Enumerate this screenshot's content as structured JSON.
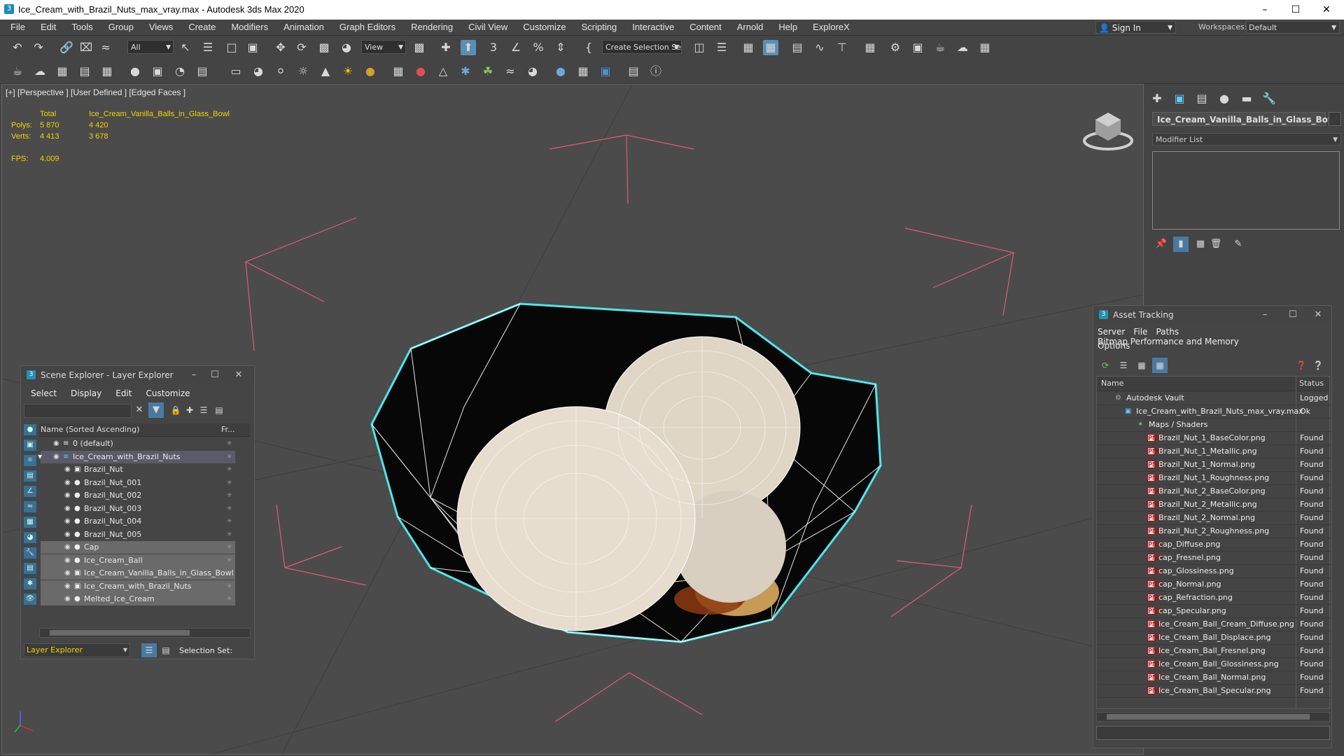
{
  "window": {
    "title": "Ice_Cream_with_Brazil_Nuts_max_vray.max - Autodesk 3ds Max 2020"
  },
  "menu": [
    "File",
    "Edit",
    "Tools",
    "Group",
    "Views",
    "Create",
    "Modifiers",
    "Animation",
    "Graph Editors",
    "Rendering",
    "Civil View",
    "Customize",
    "Scripting",
    "Interactive",
    "Content",
    "Arnold",
    "Help",
    "ExploreX"
  ],
  "account": {
    "sign_in": "Sign In",
    "workspaces_label": "Workspaces:",
    "workspace": "Default"
  },
  "toolbar": {
    "selection_filter": "All",
    "ref_coord": "View",
    "create_selection_set": "Create Selection Se"
  },
  "viewport": {
    "label": "[+] [Perspective ] [User Defined ] [Edged Faces ]",
    "stats": {
      "total_label": "Total",
      "object_name": "Ice_Cream_Vanilla_Balls_in_Glass_Bowl",
      "polys_label": "Polys:",
      "polys_total": "5 870",
      "polys_obj": "4 420",
      "verts_label": "Verts:",
      "verts_total": "4 413",
      "verts_obj": "3 678",
      "fps_label": "FPS:",
      "fps": "4.009"
    }
  },
  "command_panel": {
    "object_name": "Ice_Cream_Vanilla_Balls_in_Glass_Bowl",
    "modifier_list": "Modifier List"
  },
  "scene_explorer": {
    "title": "Scene Explorer - Layer Explorer",
    "menu": [
      "Select",
      "Display",
      "Edit",
      "Customize"
    ],
    "col_name": "Name (Sorted Ascending)",
    "col_frozen": "Fr...",
    "rows": [
      {
        "label": "0 (default)",
        "indent": 1
      },
      {
        "label": "Ice_Cream_with_Brazil_Nuts",
        "indent": 1
      },
      {
        "label": "Brazil_Nut",
        "indent": 2
      },
      {
        "label": "Brazil_Nut_001",
        "indent": 2
      },
      {
        "label": "Brazil_Nut_002",
        "indent": 2
      },
      {
        "label": "Brazil_Nut_003",
        "indent": 2
      },
      {
        "label": "Brazil_Nut_004",
        "indent": 2
      },
      {
        "label": "Brazil_Nut_005",
        "indent": 2
      },
      {
        "label": "Cap",
        "indent": 2
      },
      {
        "label": "Ice_Cream_Ball",
        "indent": 2
      },
      {
        "label": "Ice_Cream_Vanilla_Balls_in_Glass_Bowl",
        "indent": 2
      },
      {
        "label": "Ice_Cream_with_Brazil_Nuts",
        "indent": 2
      },
      {
        "label": "Melted_Ice_Cream",
        "indent": 2
      }
    ],
    "footer_layer": "Layer Explorer",
    "footer_selset": "Selection Set:"
  },
  "asset_tracking": {
    "title": "Asset Tracking",
    "menu": [
      "Server",
      "File",
      "Paths",
      "Bitmap Performance and Memory"
    ],
    "menu2": "Options",
    "col_name": "Name",
    "col_status": "Status",
    "rows": [
      {
        "name": "Autodesk Vault",
        "status": "Logged",
        "level": 0
      },
      {
        "name": "Ice_Cream_with_Brazil_Nuts_max_vray.max",
        "status": "Ok",
        "level": 1
      },
      {
        "name": "Maps / Shaders",
        "status": "",
        "level": 2
      },
      {
        "name": "Brazil_Nut_1_BaseColor.png",
        "status": "Found",
        "level": 3
      },
      {
        "name": "Brazil_Nut_1_Metallic.png",
        "status": "Found",
        "level": 3
      },
      {
        "name": "Brazil_Nut_1_Normal.png",
        "status": "Found",
        "level": 3
      },
      {
        "name": "Brazil_Nut_1_Roughness.png",
        "status": "Found",
        "level": 3
      },
      {
        "name": "Brazil_Nut_2_BaseColor.png",
        "status": "Found",
        "level": 3
      },
      {
        "name": "Brazil_Nut_2_Metallic.png",
        "status": "Found",
        "level": 3
      },
      {
        "name": "Brazil_Nut_2_Normal.png",
        "status": "Found",
        "level": 3
      },
      {
        "name": "Brazil_Nut_2_Roughness.png",
        "status": "Found",
        "level": 3
      },
      {
        "name": "cap_Diffuse.png",
        "status": "Found",
        "level": 3
      },
      {
        "name": "cap_Fresnel.png",
        "status": "Found",
        "level": 3
      },
      {
        "name": "cap_Glossiness.png",
        "status": "Found",
        "level": 3
      },
      {
        "name": "cap_Normal.png",
        "status": "Found",
        "level": 3
      },
      {
        "name": "cap_Refraction.png",
        "status": "Found",
        "level": 3
      },
      {
        "name": "cap_Specular.png",
        "status": "Found",
        "level": 3
      },
      {
        "name": "Ice_Cream_Ball_Cream_Diffuse.png",
        "status": "Found",
        "level": 3
      },
      {
        "name": "Ice_Cream_Ball_Displace.png",
        "status": "Found",
        "level": 3
      },
      {
        "name": "Ice_Cream_Ball_Fresnel.png",
        "status": "Found",
        "level": 3
      },
      {
        "name": "Ice_Cream_Ball_Glossiness.png",
        "status": "Found",
        "level": 3
      },
      {
        "name": "Ice_Cream_Ball_Normal.png",
        "status": "Found",
        "level": 3
      },
      {
        "name": "Ice_Cream_Ball_Specular.png",
        "status": "Found",
        "level": 3
      }
    ]
  },
  "colors": {
    "accent": "#5ec8ff",
    "stats": "#f2d400",
    "selection": "#4ee6ee",
    "wireframe": "#ffffff"
  }
}
